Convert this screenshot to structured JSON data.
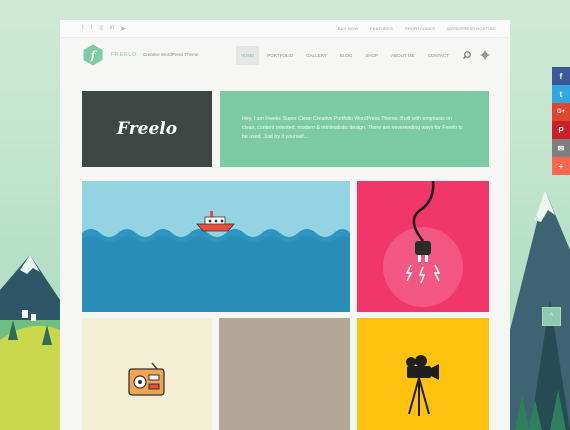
{
  "topbar": {
    "social_icons": [
      "twitter-icon",
      "facebook-icon",
      "google-plus-icon",
      "linkedin-icon",
      "youtube-icon"
    ],
    "links": [
      "BUY NOW",
      "FEATURES",
      "SHORTCODES",
      "WORDPRESS HOSTING"
    ]
  },
  "header": {
    "logo_letter": "f",
    "brand_name": "FREELO",
    "tagline": "Creative WordPress Theme",
    "nav": [
      {
        "label": "HOME",
        "active": true
      },
      {
        "label": "PORTFOLIO",
        "active": false
      },
      {
        "label": "GALLERY",
        "active": false
      },
      {
        "label": "BLOG",
        "active": false
      },
      {
        "label": "SHOP",
        "active": false
      },
      {
        "label": "ABOUT ME",
        "active": false
      },
      {
        "label": "CONTACT",
        "active": false
      }
    ]
  },
  "hero": {
    "title": "Freelo",
    "intro": "Hey, I am Freelo: Super Clean Creative Portfolio WordPress Theme. Built with emphasis on clean, content oriented, modern & minimalistic design. There are neverending ways for Freelo to be used. Just try it yourself..."
  },
  "share_bar": {
    "items": [
      {
        "icon": "facebook-icon",
        "glyph": "f",
        "color": "#3b5998"
      },
      {
        "icon": "twitter-icon",
        "glyph": "t",
        "color": "#2fa9e0"
      },
      {
        "icon": "google-plus-icon",
        "glyph": "G+",
        "color": "#e0452f"
      },
      {
        "icon": "pinterest-icon",
        "glyph": "P",
        "color": "#cb2027"
      },
      {
        "icon": "mail-icon",
        "glyph": "✉",
        "color": "#7f7f7f"
      },
      {
        "icon": "more-icon",
        "glyph": "+",
        "color": "#ff6550"
      }
    ]
  },
  "scroll_top": {
    "glyph": "^"
  },
  "colors": {
    "accent": "#7dcaa6",
    "dark": "#404644",
    "pink": "#f0366b",
    "yellow": "#ffc20e",
    "sky": "#93d3e2"
  }
}
